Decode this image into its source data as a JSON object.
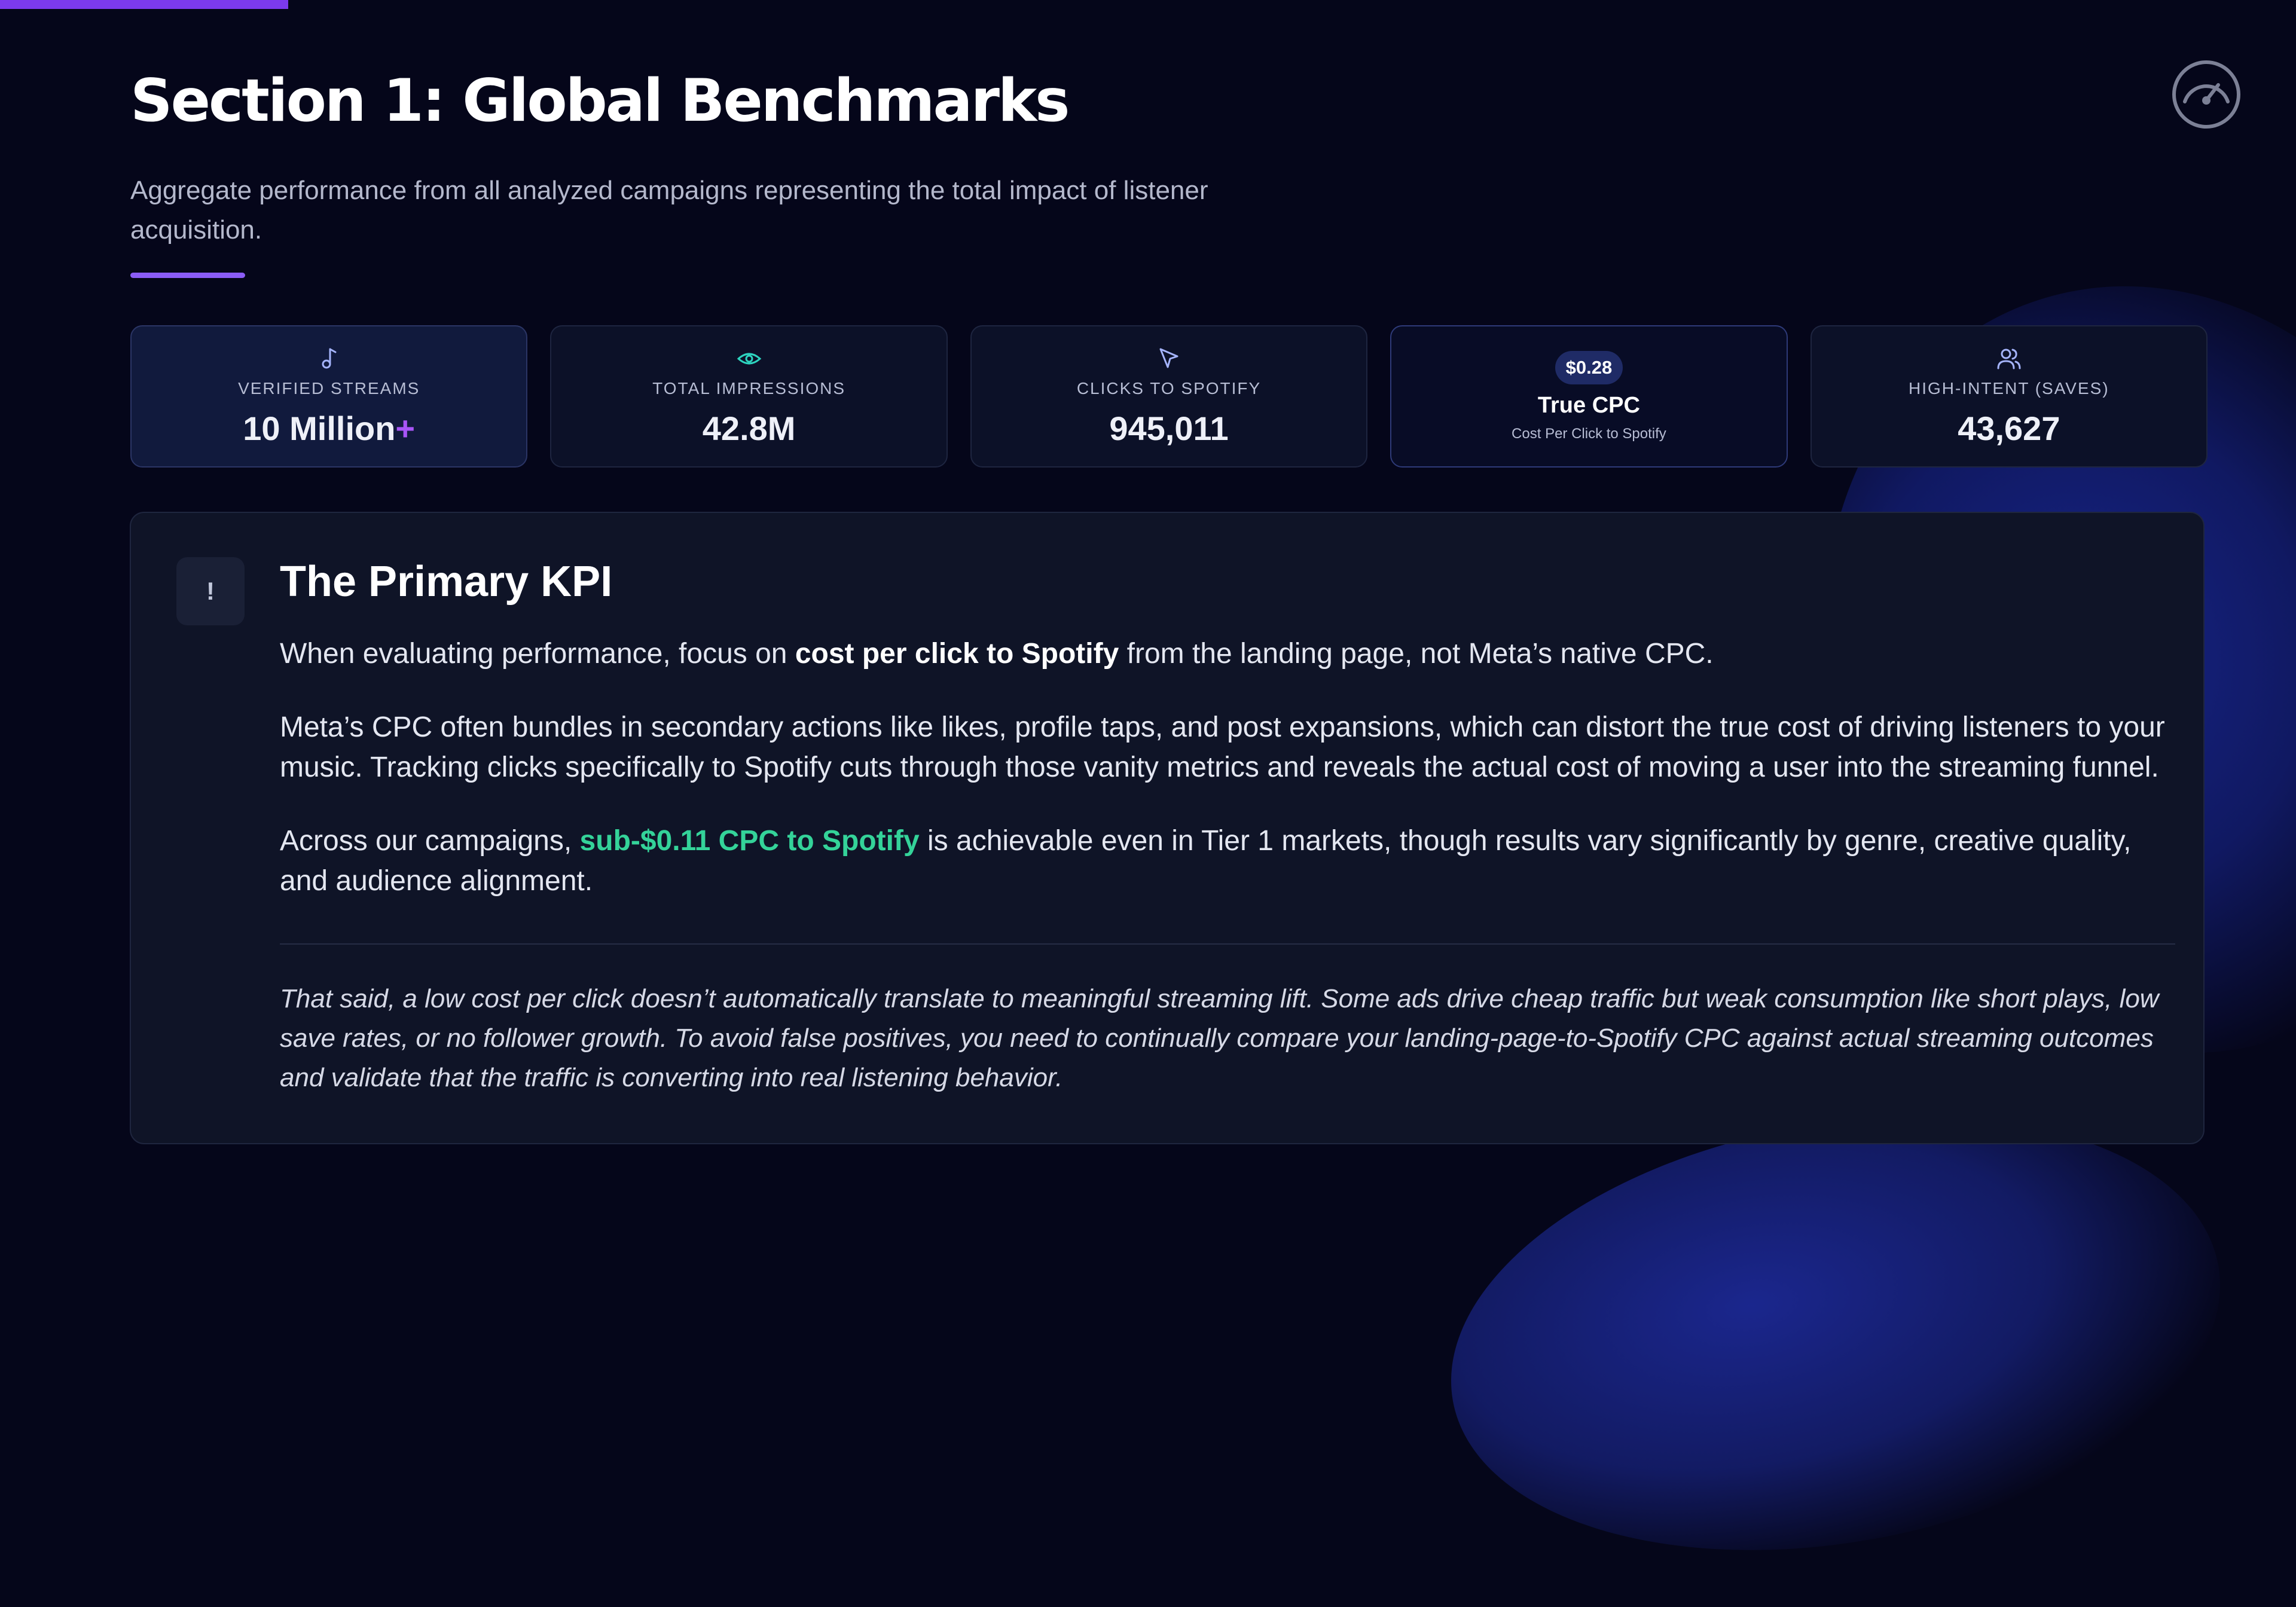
{
  "header": {
    "title": "Section 1: Global Benchmarks",
    "subtitle": "Aggregate performance from all analyzed campaigns representing the total impact of listener acquisition."
  },
  "icons": {
    "logo": "speedometer-logo-icon",
    "streams": "music-note-icon",
    "impressions": "eye-icon",
    "clicks": "cursor-arrow-icon",
    "saves": "users-icon",
    "alert": "exclamation-icon"
  },
  "colors": {
    "accent": "#8b5cf6",
    "highlight_green": "#34d399",
    "background": "#05061a"
  },
  "stats": {
    "streams": {
      "label": "VERIFIED STREAMS",
      "value": "10 Million",
      "suffix": "+"
    },
    "impressions": {
      "label": "TOTAL IMPRESSIONS",
      "value": "42.8M"
    },
    "clicks": {
      "label": "CLICKS TO SPOTIFY",
      "value": "945,011"
    },
    "cpc": {
      "badge": "$0.28",
      "title": "True CPC",
      "subtitle": "Cost Per Click to Spotify"
    },
    "saves": {
      "label": "HIGH-INTENT (SAVES)",
      "value": "43,627"
    }
  },
  "kpi": {
    "alert_glyph": "!",
    "title": "The Primary KPI",
    "p1_a": "When evaluating performance, focus on ",
    "p1_bold": "cost per click to Spotify",
    "p1_b": " from the landing page, not Meta’s native CPC.",
    "p2": "Meta’s CPC often bundles in secondary actions like likes, profile taps, and post expansions, which can distort the true cost of driving listeners to your music. Tracking clicks specifically to Spotify cuts through those vanity metrics and reveals the actual cost of moving a user into the streaming funnel.",
    "p3_a": "Across our campaigns, ",
    "p3_green": "sub-$0.11 CPC to Spotify",
    "p3_b": " is achievable even in Tier 1 markets, though results vary significantly by genre, creative quality, and audience alignment.",
    "note": "That said, a low cost per click doesn’t automatically translate to meaningful streaming lift. Some ads drive cheap traffic but weak consumption like short plays, low save rates, or no follower growth. To avoid false positives, you need to continually compare your landing-page-to-Spotify CPC against actual streaming outcomes and validate that the traffic is converting into real listening behavior."
  }
}
